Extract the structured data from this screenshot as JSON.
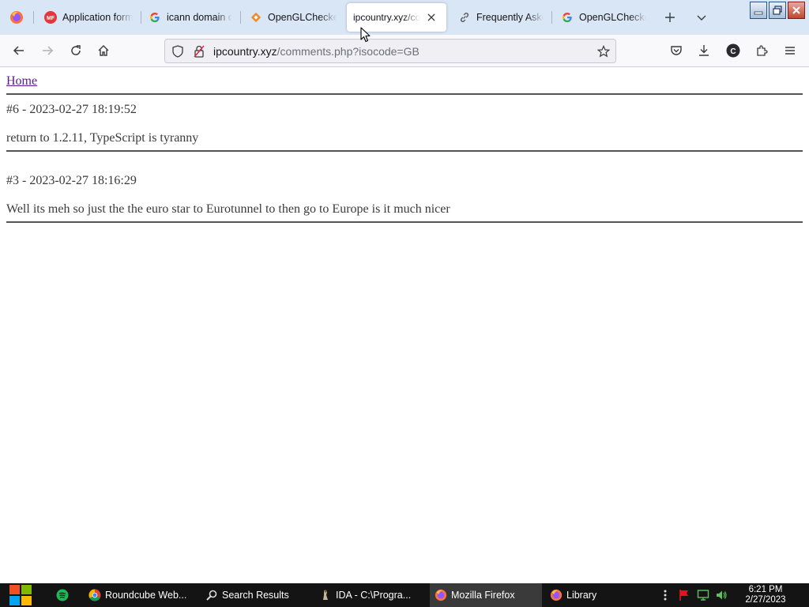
{
  "browser": {
    "tabs": [
      {
        "label": "Application form",
        "icon": "form-app-icon",
        "active": false
      },
      {
        "label": "icann domain cre",
        "icon": "google-icon",
        "active": false
      },
      {
        "label": "OpenGLChecker",
        "icon": "opengl-checker-icon",
        "active": false
      },
      {
        "label": "ipcountry.xyz/co",
        "icon": "",
        "active": true
      },
      {
        "label": "Frequently Aske",
        "icon": "link-icon",
        "active": false
      },
      {
        "label": "OpenGLChecke",
        "icon": "google-icon",
        "active": false
      }
    ],
    "url_host": "ipcountry.xyz",
    "url_path": "/comments.php?isocode=GB"
  },
  "page": {
    "home_link": "Home",
    "comments": [
      {
        "header": "#6 - 2023-02-27 18:19:52",
        "text": "return to 1.2.11, TypeScript is tyranny"
      },
      {
        "header": "#3 - 2023-02-27 18:16:29",
        "text": "Well its meh so just the the euro star to Eurotunnel to then go to Europe is it much nicer"
      }
    ]
  },
  "taskbar": {
    "items": [
      {
        "label": "Roundcube Web...",
        "icon": "chrome-icon",
        "active": false
      },
      {
        "label": "Search Results",
        "icon": "search-icon",
        "active": false
      },
      {
        "label": "IDA - C:\\Progra...",
        "icon": "ida-icon",
        "active": false
      },
      {
        "label": "Mozilla Firefox",
        "icon": "firefox-icon",
        "active": true
      },
      {
        "label": "Library",
        "icon": "firefox-icon",
        "active": false
      }
    ],
    "clock_time": "6:21 PM",
    "clock_date": "2/27/2023"
  },
  "colors": {
    "tabbar_bg": "#d9e6f5",
    "link_visited": "#551a8b",
    "taskbar_bg": "#141414"
  }
}
